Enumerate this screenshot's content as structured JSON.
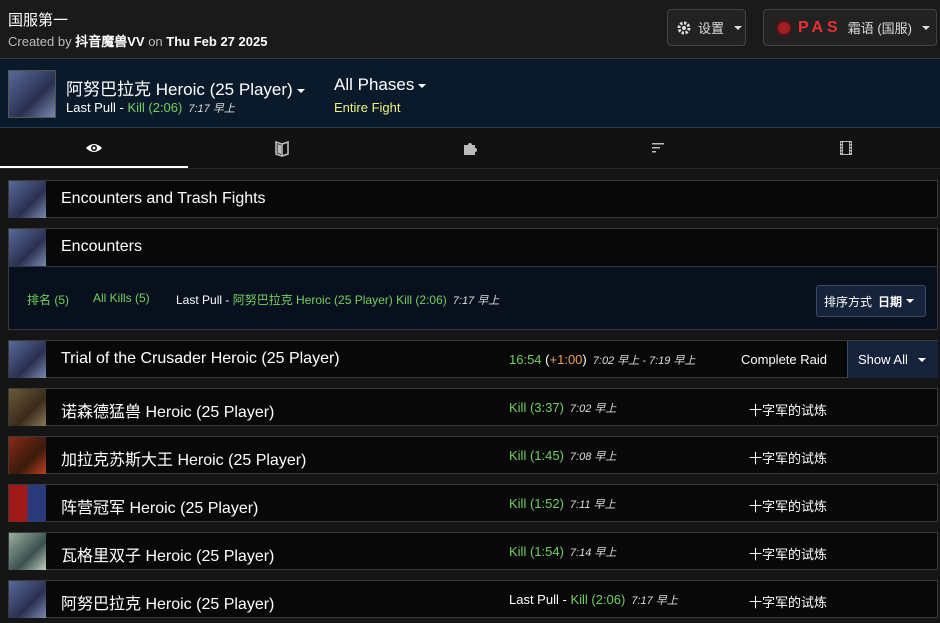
{
  "header": {
    "title": "国服第一",
    "created_by_prefix": "Created by",
    "author": "抖音魔兽VV",
    "date_prefix": "on",
    "date": "Thu Feb 27 2025",
    "settings_label": "设置",
    "account_tag": "PAS",
    "account_name": "霜语 (国服)"
  },
  "fight": {
    "name": "阿努巴拉克 Heroic (25 Player)",
    "last_pull_label": "Last Pull",
    "result": "Kill (2:06)",
    "time": "7:17 早上",
    "phases_label": "All Phases",
    "phase_sub": "Entire Fight"
  },
  "tabs": [
    {
      "name": "summary",
      "icon": "eye-icon"
    },
    {
      "name": "damage",
      "icon": "book-icon"
    },
    {
      "name": "auras",
      "icon": "puzzle-icon"
    },
    {
      "name": "rankings",
      "icon": "sort-icon"
    },
    {
      "name": "timeline",
      "icon": "film-icon"
    }
  ],
  "encounters_trash": {
    "label": "Encounters and Trash Fights"
  },
  "encounters": {
    "label": "Encounters",
    "ranks": "排名 (5)",
    "all_kills": "All Kills (5)",
    "last_pull_label": "Last Pull",
    "last_pull_fight": "阿努巴拉克 Heroic (25 Player) Kill (2:06)",
    "last_pull_time": "7:17 早上",
    "sort_label": "排序方式",
    "sort_value": "日期"
  },
  "raid": {
    "name": "Trial of the Crusader Heroic (25 Player)",
    "duration": "16:54",
    "delta": "+1:00",
    "time_range": "7:02 早上 -  7:19 早上",
    "status": "Complete Raid",
    "show_all": "Show All"
  },
  "fights": [
    {
      "name": "诺森德猛兽 Heroic (25 Player)",
      "result": "Kill (3:37)",
      "time": "7:02 早上",
      "zone": "十字军的试炼",
      "last_pull": ""
    },
    {
      "name": "加拉克苏斯大王 Heroic (25 Player)",
      "result": "Kill (1:45)",
      "time": "7:08 早上",
      "zone": "十字军的试炼",
      "last_pull": ""
    },
    {
      "name": "阵营冠军 Heroic (25 Player)",
      "result": "Kill (1:52)",
      "time": "7:11 早上",
      "zone": "十字军的试炼",
      "last_pull": ""
    },
    {
      "name": "瓦格里双子 Heroic (25 Player)",
      "result": "Kill (1:54)",
      "time": "7:14 早上",
      "zone": "十字军的试炼",
      "last_pull": ""
    },
    {
      "name": "阿努巴拉克 Heroic (25 Player)",
      "result": "Kill (2:06)",
      "time": "7:17 早上",
      "zone": "十字军的试炼",
      "last_pull": "Last Pull"
    }
  ],
  "colors": {
    "kill": "#70d060",
    "delta": "#f0a060",
    "phase": "#f0f080",
    "brand": "#e83030"
  }
}
